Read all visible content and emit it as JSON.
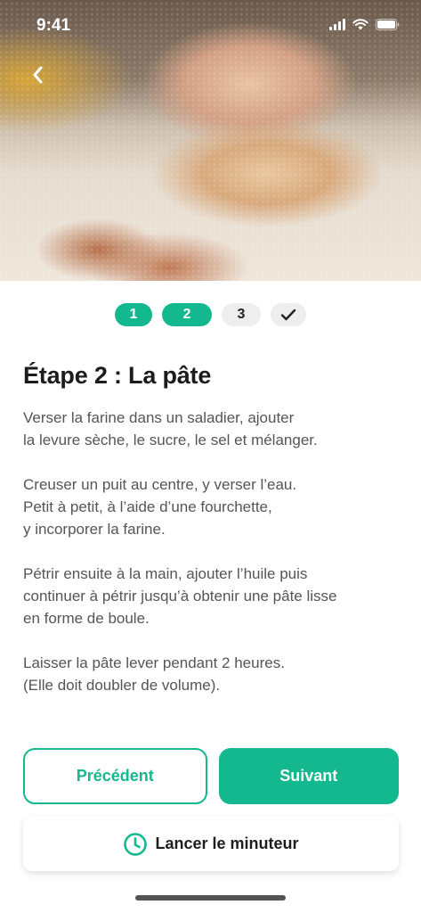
{
  "status_bar": {
    "time": "9:41"
  },
  "stepper": {
    "steps": [
      {
        "label": "1",
        "state": "done"
      },
      {
        "label": "2",
        "state": "current"
      },
      {
        "label": "3",
        "state": "todo"
      },
      {
        "label": "",
        "icon": "checkmark-icon",
        "state": "finish"
      }
    ]
  },
  "step": {
    "title": "Étape 2 : La pâte",
    "paragraphs": [
      [
        "Verser la farine dans un saladier, ajouter",
        "la levure sèche, le sucre, le sel et mélanger."
      ],
      [
        "Creuser un puit au centre, y verser l’eau.",
        "Petit à petit, à l’aide d’une fourchette,",
        "y incorporer la farine."
      ],
      [
        "Pétrir ensuite à la main, ajouter l’huile puis",
        "continuer à pétrir jusqu’à obtenir une pâte lisse",
        "en forme de boule."
      ],
      [
        "Laisser la pâte lever pendant 2 heures.",
        "(Elle doit doubler de volume)."
      ]
    ]
  },
  "actions": {
    "previous_label": "Précédent",
    "next_label": "Suivant",
    "timer_label": "Lancer le minuteur"
  },
  "icons": {
    "back": "back-arrow-icon",
    "timer": "clock-icon",
    "done": "checkmark-icon"
  },
  "colors": {
    "accent": "#14b88f",
    "text": "#1c1c1c",
    "body_text": "#555555",
    "chip_inactive": "#eeeeee"
  }
}
